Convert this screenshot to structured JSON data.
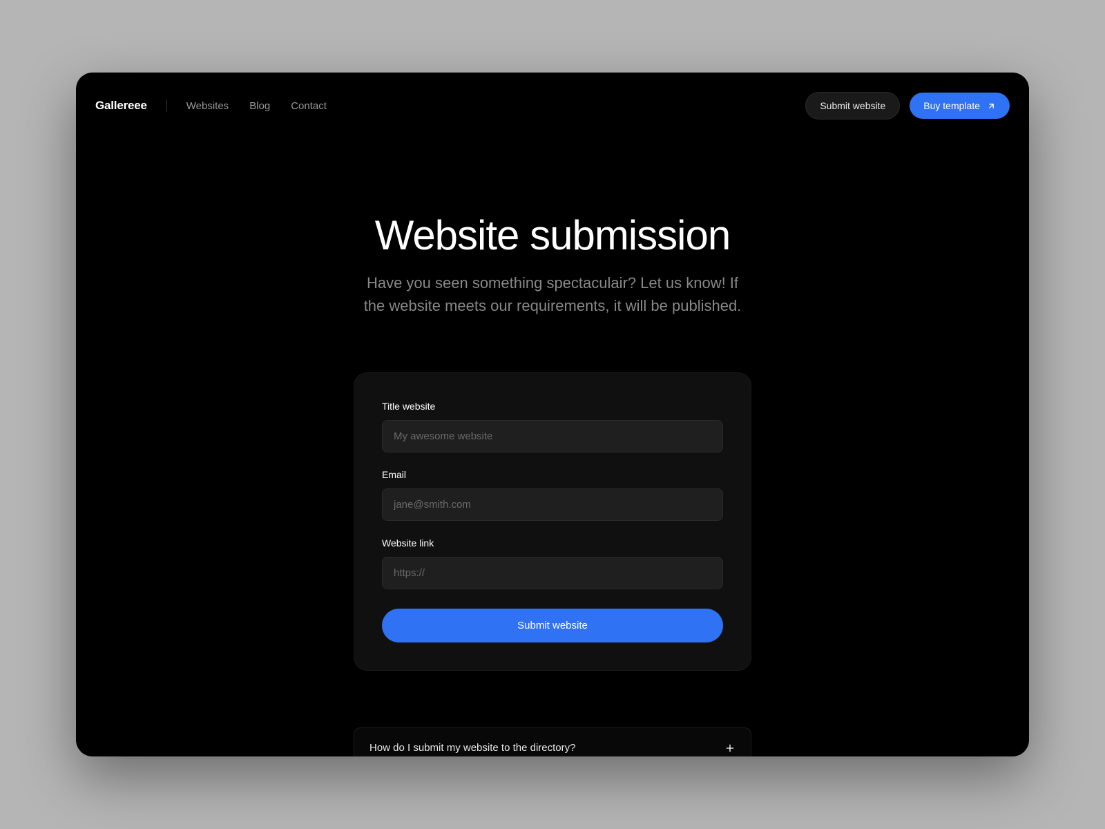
{
  "header": {
    "logo": "Gallereee",
    "nav": [
      {
        "label": "Websites"
      },
      {
        "label": "Blog"
      },
      {
        "label": "Contact"
      }
    ],
    "submit_label": "Submit website",
    "buy_label": "Buy template"
  },
  "hero": {
    "title": "Website submission",
    "subtitle": "Have you seen something spectaculair? Let us know! If the website meets our requirements, it will be published."
  },
  "form": {
    "title_label": "Title website",
    "title_placeholder": "My awesome website",
    "email_label": "Email",
    "email_placeholder": "jane@smith.com",
    "link_label": "Website link",
    "link_placeholder": "https://",
    "submit_label": "Submit website"
  },
  "faq": {
    "items": [
      {
        "question": "How do I submit my website to the directory?"
      }
    ]
  },
  "colors": {
    "accent": "#2f72f3",
    "background": "#000000",
    "card": "#101010",
    "input": "#1f1f1f"
  }
}
